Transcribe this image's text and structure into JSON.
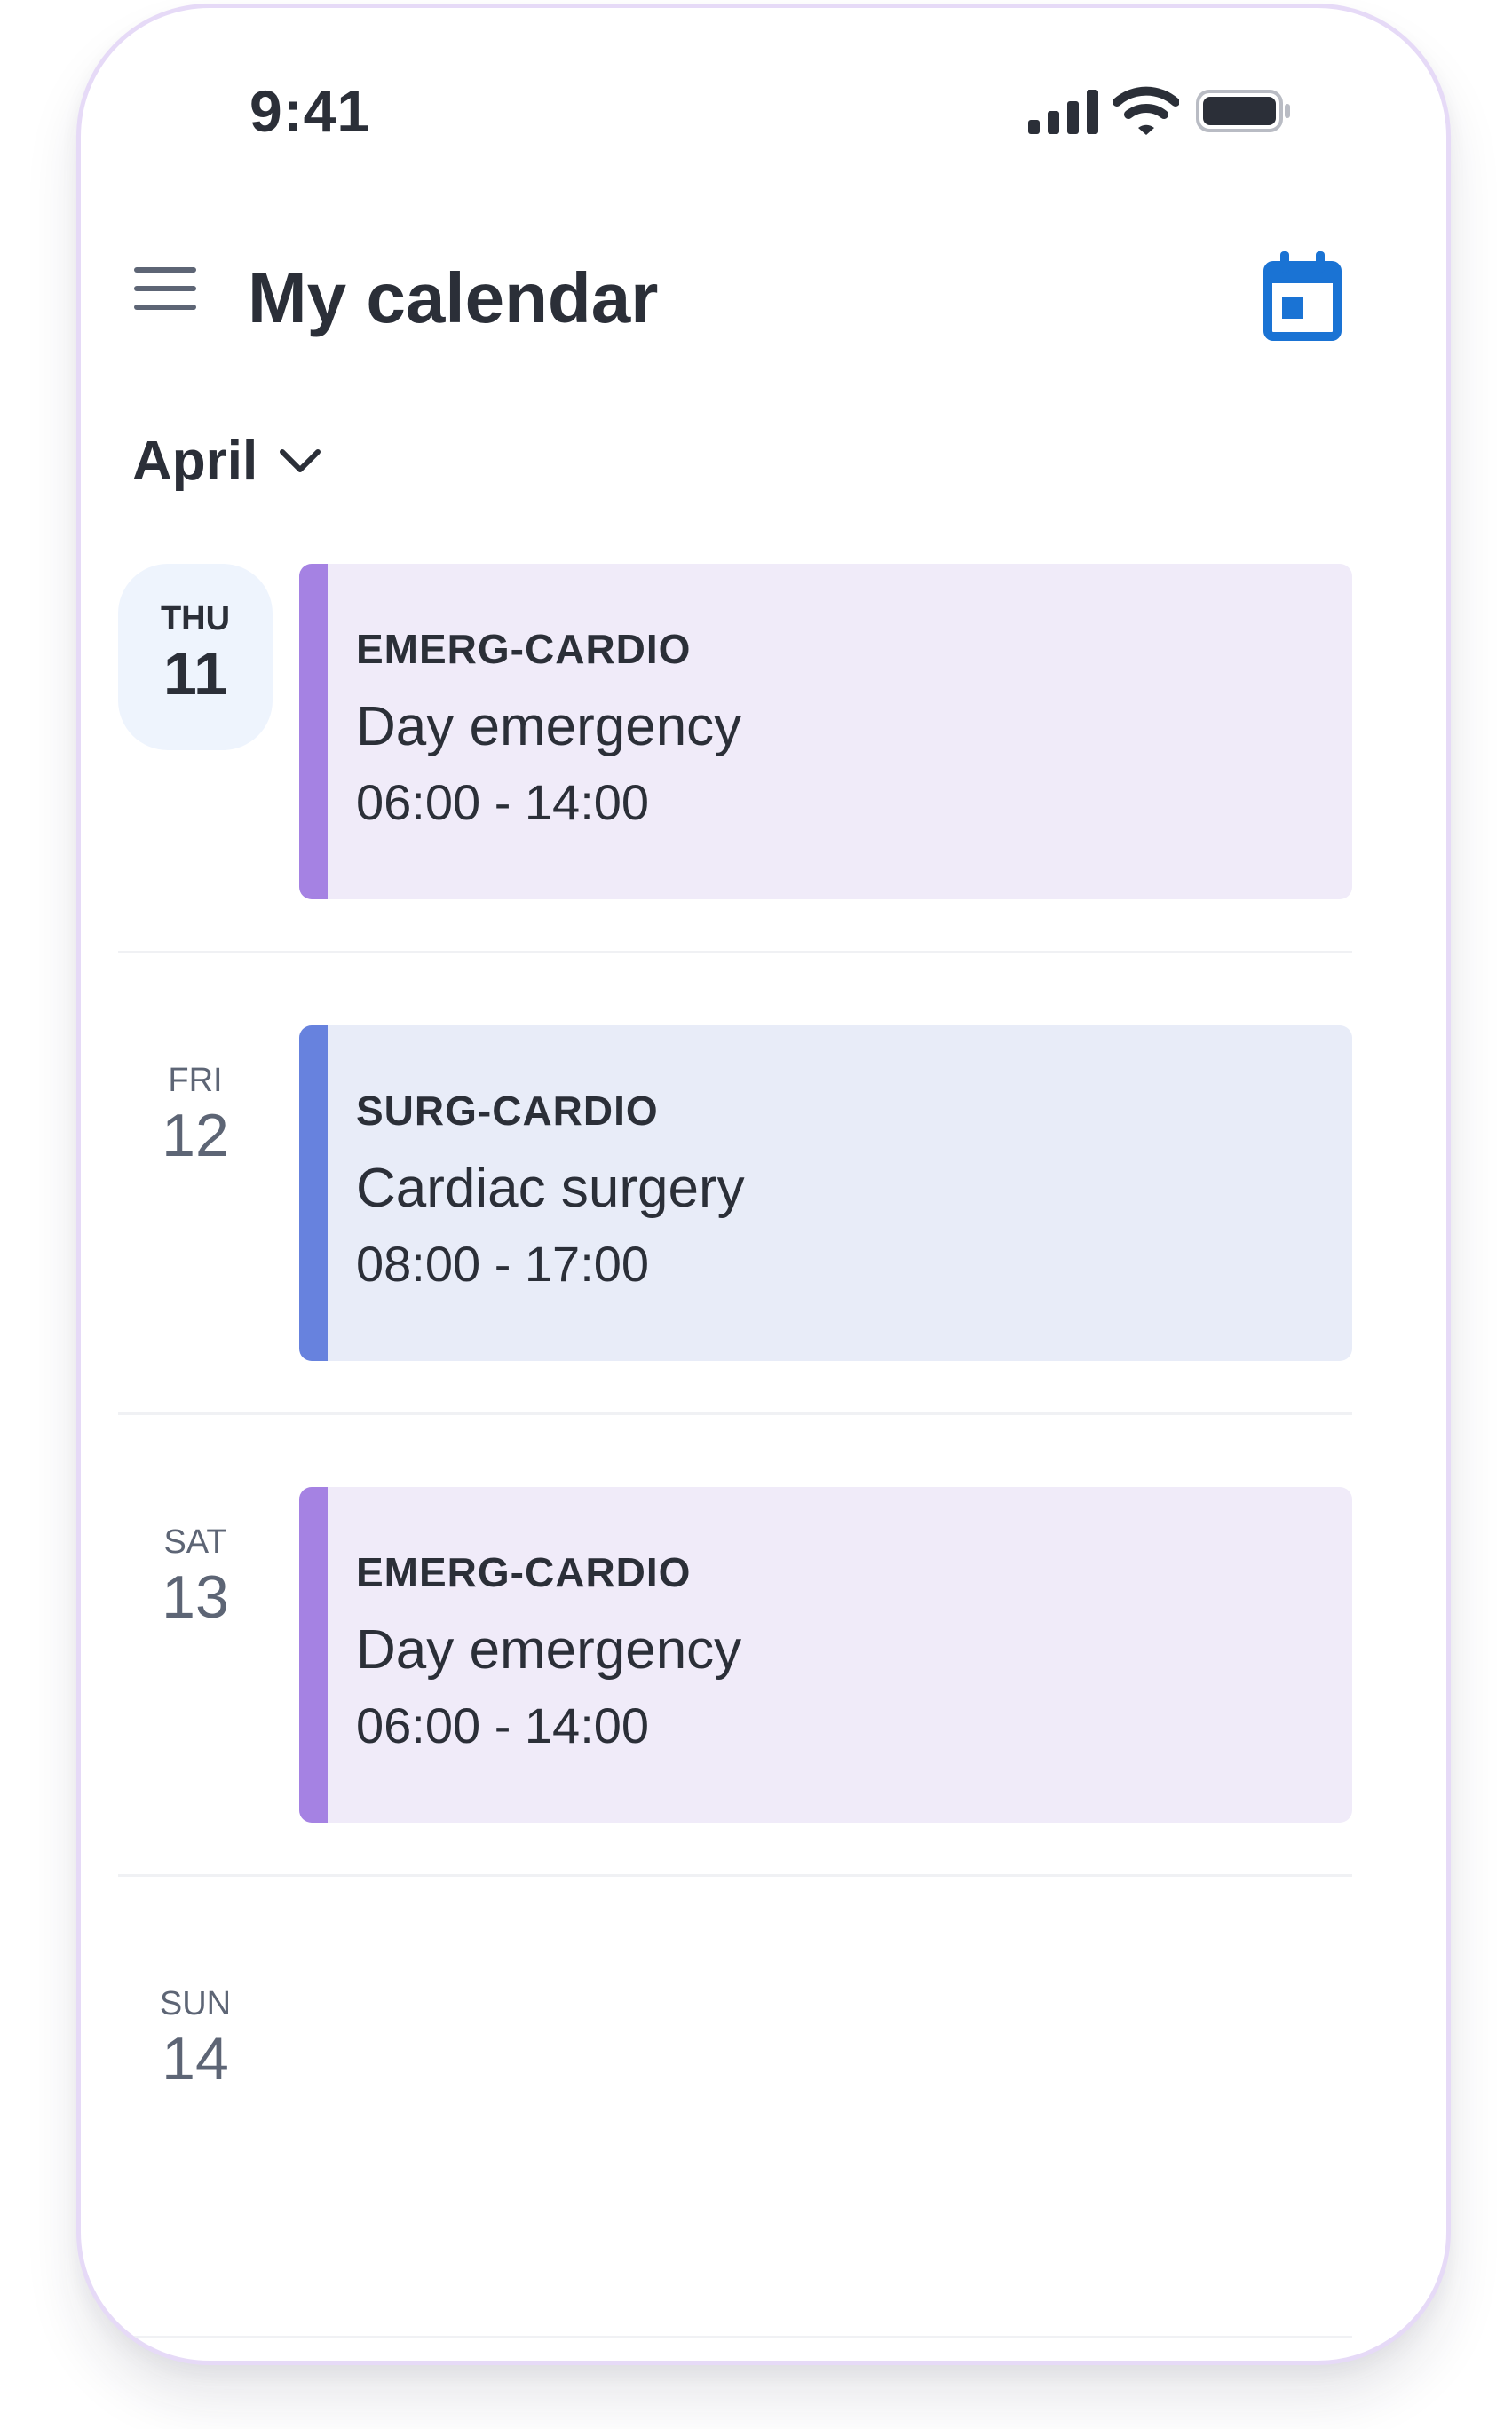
{
  "status_bar": {
    "time": "9:41",
    "signal_icon": "cellular-signal-icon",
    "wifi_icon": "wifi-icon",
    "battery_icon": "battery-icon"
  },
  "header": {
    "menu_icon": "hamburger-menu-icon",
    "title": "My calendar",
    "calendar_icon": "calendar-icon",
    "accent_color": "#1a73d4"
  },
  "month_selector": {
    "value": "April",
    "icon": "chevron-down-icon"
  },
  "days": [
    {
      "weekday": "THU",
      "day": "11",
      "today": true,
      "event": {
        "code": "EMERG-CARDIO",
        "title": "Day emergency",
        "time": "06:00 - 14:00",
        "bar_color": "#a582e3",
        "bg_color": "#f0ebf9"
      }
    },
    {
      "weekday": "FRI",
      "day": "12",
      "today": false,
      "event": {
        "code": "SURG-CARDIO",
        "title": "Cardiac surgery",
        "time": "08:00 - 17:00",
        "bar_color": "#6782de",
        "bg_color": "#e8ecf8"
      }
    },
    {
      "weekday": "SAT",
      "day": "13",
      "today": false,
      "event": {
        "code": "EMERG-CARDIO",
        "title": "Day emergency",
        "time": "06:00 - 14:00",
        "bar_color": "#a582e3",
        "bg_color": "#f0ebf9"
      }
    },
    {
      "weekday": "SUN",
      "day": "14",
      "today": false
    }
  ]
}
